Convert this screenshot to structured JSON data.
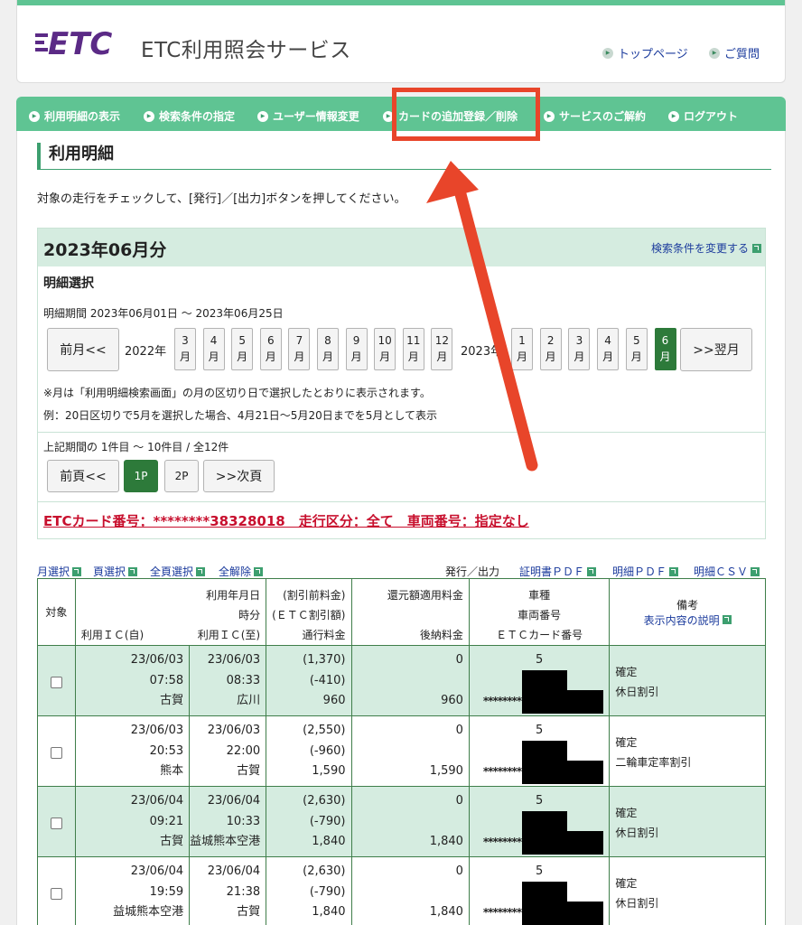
{
  "header": {
    "logo_text": "ETC",
    "site_title": "ETC利用照会サービス",
    "links": [
      "トップページ",
      "ご質問"
    ]
  },
  "nav": {
    "items": [
      "利用明細の表示",
      "検索条件の指定",
      "ユーザー情報変更",
      "カードの追加登録／削除",
      "サービスのご解約",
      "ログアウト"
    ]
  },
  "main": {
    "page_title": "利用明細",
    "instruction": "対象の走行をチェックして、[発行]／[出力]ボタンを押してください。",
    "period": {
      "title": "2023年06月分",
      "change_link": "検索条件を変更する",
      "select_heading": "明細選択",
      "range": "明細期間 2023年06月01日 〜 2023年06月25日",
      "prev_month": "前月<<",
      "next_month": ">>翌月",
      "year1": "2022年",
      "year2": "2023年",
      "months_2022": [
        "3",
        "4",
        "5",
        "6",
        "7",
        "8",
        "9",
        "10",
        "11",
        "12"
      ],
      "months_2023": [
        "1",
        "2",
        "3",
        "4",
        "5",
        "6"
      ],
      "month_suffix": "月",
      "active_month": "6",
      "note1": "※月は「利用明細検索画面」の月の区切り日で選択したとおりに表示されます。",
      "note2": "例：20日区切りで5月を選択した場合、4月21日〜5月20日までを5月として表示",
      "page_range": "上記期間の 1件目 〜 10件目 / 全12件",
      "prev_page": "前頁<<",
      "pages": [
        "1P",
        "2P"
      ],
      "next_page": ">>次頁",
      "card_line": "ETCカード番号：********38328018　走行区分：全て　車両番号：指定なし"
    },
    "select_links": [
      "月選択",
      "頁選択",
      "全頁選択",
      "全解除"
    ],
    "issue_label": "発行／出力",
    "output_links": [
      "証明書ＰＤＦ",
      "明細ＰＤＦ",
      "明細ＣＳＶ"
    ],
    "table": {
      "headers": {
        "target": "対象",
        "date_time": [
          "利用年月日",
          "時分"
        ],
        "ic_from": "利用ＩＣ(自)",
        "ic_to": "利用ＩＣ(至)",
        "fee": [
          "(割引前料金)",
          "(ＥＴＣ割引額)",
          "通行料金"
        ],
        "refund": [
          "還元額適用料金",
          "後納料金"
        ],
        "vehicle": [
          "車種",
          "車両番号",
          "ＥＴＣカード番号"
        ],
        "remark": "備考",
        "remark_link": "表示内容の説明"
      },
      "rows": [
        {
          "date1": "23/06/03",
          "time1": "07:58",
          "ic1": "古賀",
          "date2": "23/06/03",
          "time2": "08:33",
          "ic2": "広川",
          "before": "(1,370)",
          "discount": "(-410)",
          "toll": "960",
          "refund": "0",
          "deferred": "960",
          "type": "5",
          "card_mask": "********",
          "status": "確定",
          "discount_name": "休日割引"
        },
        {
          "date1": "23/06/03",
          "time1": "20:53",
          "ic1": "熊本",
          "date2": "23/06/03",
          "time2": "22:00",
          "ic2": "古賀",
          "before": "(2,550)",
          "discount": "(-960)",
          "toll": "1,590",
          "refund": "0",
          "deferred": "1,590",
          "type": "5",
          "card_mask": "********",
          "status": "確定",
          "discount_name": "二輪車定率割引"
        },
        {
          "date1": "23/06/04",
          "time1": "09:21",
          "ic1": "古賀",
          "date2": "23/06/04",
          "time2": "10:33",
          "ic2": "益城熊本空港",
          "before": "(2,630)",
          "discount": "(-790)",
          "toll": "1,840",
          "refund": "0",
          "deferred": "1,840",
          "type": "5",
          "card_mask": "********",
          "status": "確定",
          "discount_name": "休日割引"
        },
        {
          "date1": "23/06/04",
          "time1": "19:59",
          "ic1": "益城熊本空港",
          "date2": "23/06/04",
          "time2": "21:38",
          "ic2": "古賀",
          "before": "(2,630)",
          "discount": "(-790)",
          "toll": "1,840",
          "refund": "0",
          "deferred": "1,840",
          "type": "5",
          "card_mask": "********",
          "status": "確定",
          "discount_name": "休日割引"
        }
      ]
    }
  },
  "colors": {
    "accent_green": "#5fc493",
    "dark_green": "#2d7a3a",
    "row_shade": "#d5ece0",
    "link_blue": "#1a3a9c",
    "alert_red": "#c8102e",
    "annotation_red": "#e8452a"
  }
}
